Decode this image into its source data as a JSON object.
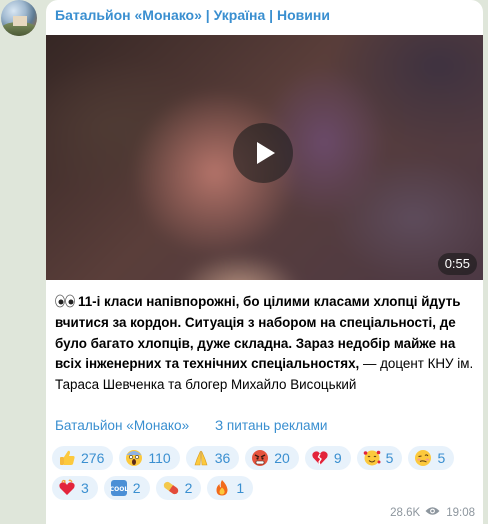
{
  "channel": {
    "name": "Батальйон «Монако» | Україна | Новини"
  },
  "video": {
    "duration": "0:55"
  },
  "message": {
    "bold_text": "11-і класи напівпорожні, бо цілими класами хлопці йдуть вчитися за кордон. Ситуація з набором на спеціальності, де було багато хлопців, дуже складна. Зараз недобір майже на всіх інженерних та технічних спеціальностях,",
    "plain_text": " — доцент КНУ ім. Тараса Шевченка та блогер Михайло Висоцький"
  },
  "links": {
    "channel_link": "Батальйон «Монако»",
    "ads_link": "З питань реклами"
  },
  "reactions": [
    {
      "icon": "thumbs-up-icon",
      "count": "276"
    },
    {
      "icon": "screaming-face-icon",
      "count": "110"
    },
    {
      "icon": "folded-hands-icon",
      "count": "36"
    },
    {
      "icon": "angry-face-icon",
      "count": "20"
    },
    {
      "icon": "broken-heart-icon",
      "count": "9"
    },
    {
      "icon": "smiling-face-hearts-icon",
      "count": "5"
    },
    {
      "icon": "woozy-face-icon",
      "count": "5"
    },
    {
      "icon": "heart-on-fire-icon",
      "count": "3"
    },
    {
      "icon": "cool-button-icon",
      "count": "2"
    },
    {
      "icon": "pill-icon",
      "count": "2"
    },
    {
      "icon": "fire-icon",
      "count": "1"
    }
  ],
  "meta": {
    "views": "28.6K",
    "time": "19:08"
  },
  "colors": {
    "accent": "#3a8fd0",
    "chip_bg": "#e8f2fb",
    "chat_bg": "#dfe6da"
  }
}
